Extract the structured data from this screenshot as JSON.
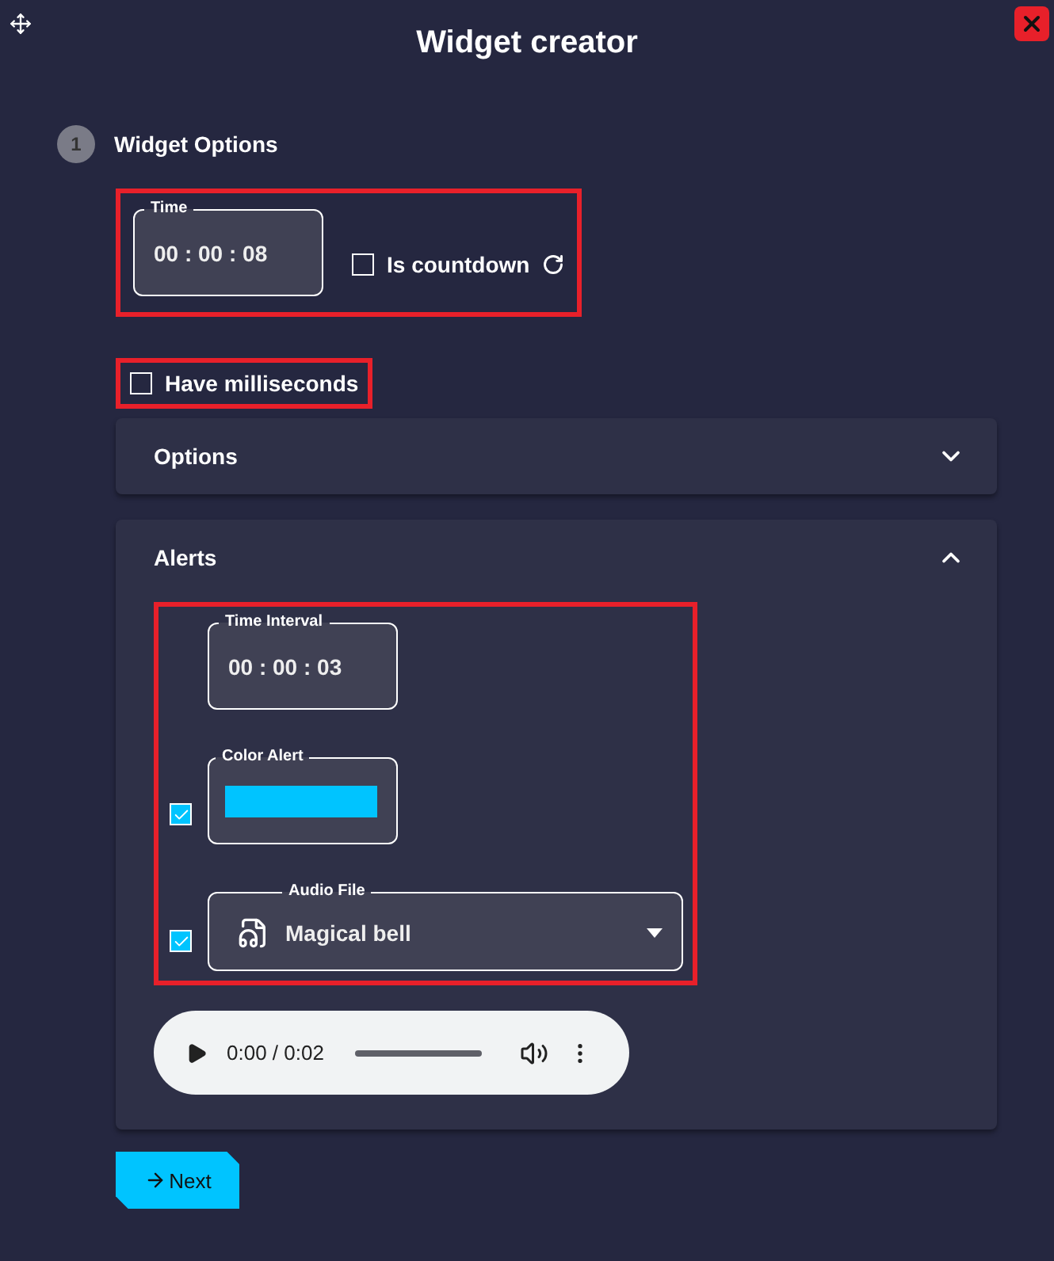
{
  "window": {
    "title": "Widget creator"
  },
  "step": {
    "number": "1",
    "label": "Widget Options"
  },
  "time": {
    "label": "Time",
    "value": "00 : 00 : 08"
  },
  "countdown": {
    "label": "Is countdown",
    "checked": false
  },
  "milliseconds": {
    "label": "Have milliseconds",
    "checked": false
  },
  "panels": [
    {
      "title": "Options",
      "expanded": false
    },
    {
      "title": "Alerts",
      "expanded": true
    }
  ],
  "alerts": {
    "interval": {
      "label": "Time Interval",
      "value": "00 : 00 : 03"
    },
    "color_alert": {
      "label": "Color Alert",
      "checked": true,
      "color": "#00c4ff"
    },
    "audio_file": {
      "label": "Audio File",
      "value": "Magical bell",
      "checked": true
    }
  },
  "player": {
    "time": "0:00 / 0:02"
  },
  "next_button": {
    "label": "Next"
  }
}
